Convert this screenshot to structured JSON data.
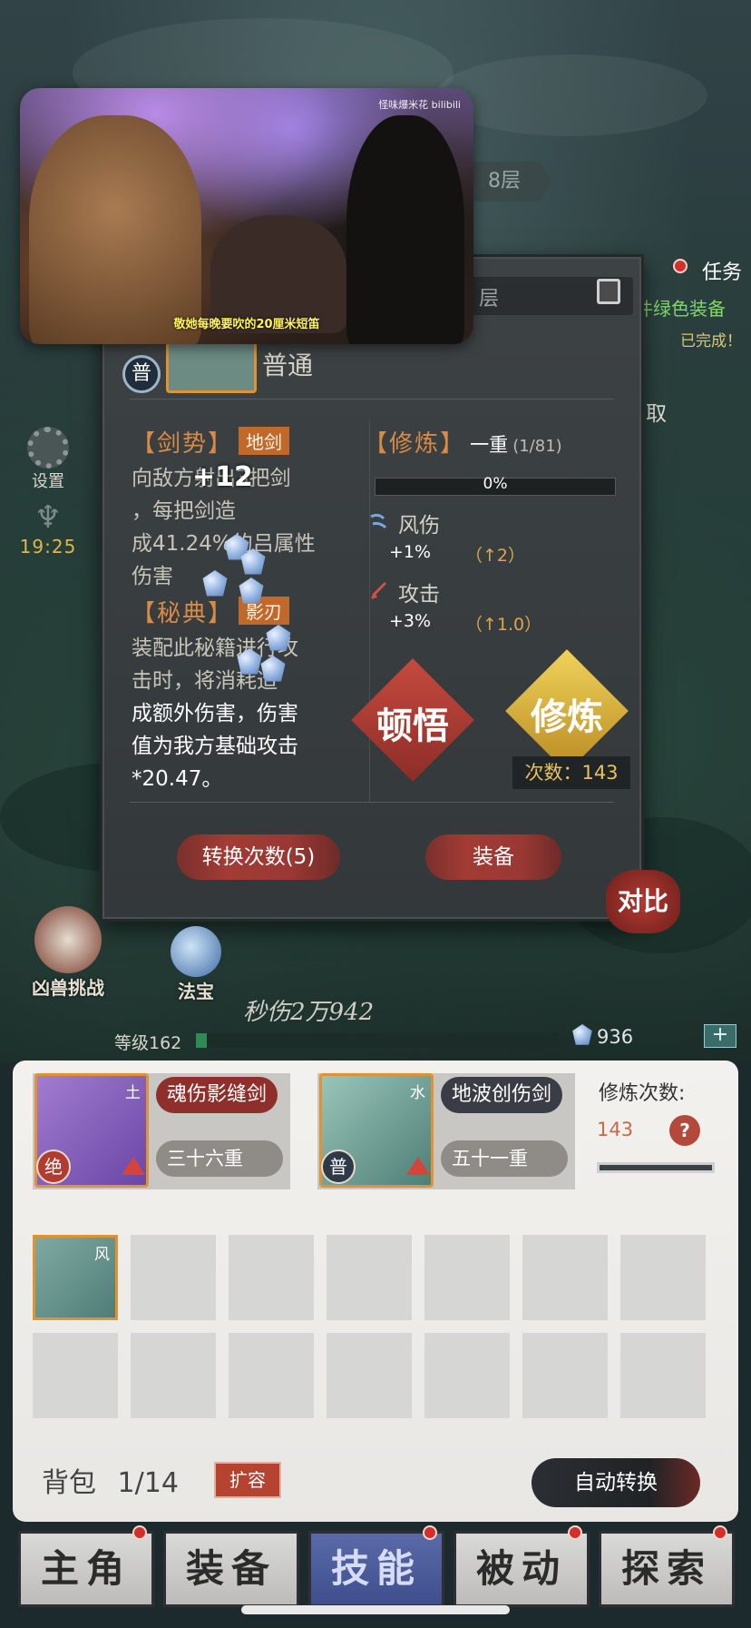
{
  "video": {
    "brand": "怪味爆米花 bilibili",
    "caption": "敬她每晚要吹的20厘米短笛"
  },
  "floor": {
    "label": "8层"
  },
  "task": {
    "title": "任务",
    "line1": "件绿色装备",
    "line2": "已完成！"
  },
  "side": {
    "settings_label": "设置",
    "time": "19:25",
    "claim_label": "取"
  },
  "modal": {
    "locked_label": "层",
    "rarity_badge": "普",
    "rarity_text": "普通",
    "sword": {
      "title": "【剑势】",
      "tag": "地剑",
      "desc_lines": [
        "向敌方射出3把剑",
        "，每把剑造",
        "成41.24%的吕属性",
        "伤害"
      ]
    },
    "secret": {
      "title": "【秘典】",
      "tag": "影刃",
      "desc_lines": [
        "装配此秘籍进行攻",
        "击时，将消耗造",
        "成额外伤害，伤害",
        "值为我方基础攻击",
        "*20.47。"
      ]
    },
    "cultivate": {
      "title": "【修炼】",
      "level": "一重",
      "level_progress": "(1/81)",
      "progress_text": "0%",
      "progress_value": 0
    },
    "stats": [
      {
        "name": "风伤",
        "value": "+1%",
        "up": "（↑2）"
      },
      {
        "name": "攻击",
        "value": "+3%",
        "up": "（↑1.0）"
      }
    ],
    "insight_label": "顿悟",
    "practice_label": "修炼",
    "count_text": "次数：143",
    "convert_button": "转换次数(5)",
    "equip_button": "装备",
    "float_number": "+12"
  },
  "compare_label": "对比",
  "lower": {
    "beast_label": "凶兽挑战",
    "treasure_label": "法宝",
    "dps_text": "秒伤2万942",
    "level_text": "等级162",
    "level_progress": 0.03,
    "gems": "936",
    "plus": "+"
  },
  "equipped": [
    {
      "element": "土",
      "name": "魂伤影缝剑",
      "rank": "绝",
      "level": "三十六重",
      "color": "#8e2f2b"
    },
    {
      "element": "水",
      "name": "地波创伤剑",
      "rank": "普",
      "level": "五十一重",
      "color": "#3a3c46"
    }
  ],
  "cultivation": {
    "label": "修炼次数:",
    "count": "143",
    "help": "?"
  },
  "bag": {
    "first_item_element": "风",
    "label": "背包",
    "count": "1/14",
    "expand_label": "扩容",
    "auto_label": "自动转换"
  },
  "tabs": [
    {
      "label": "主角",
      "badge": true
    },
    {
      "label": "装备",
      "badge": false
    },
    {
      "label": "技能",
      "badge": true,
      "active": true
    },
    {
      "label": "被动",
      "badge": true
    },
    {
      "label": "探索",
      "badge": true
    }
  ]
}
